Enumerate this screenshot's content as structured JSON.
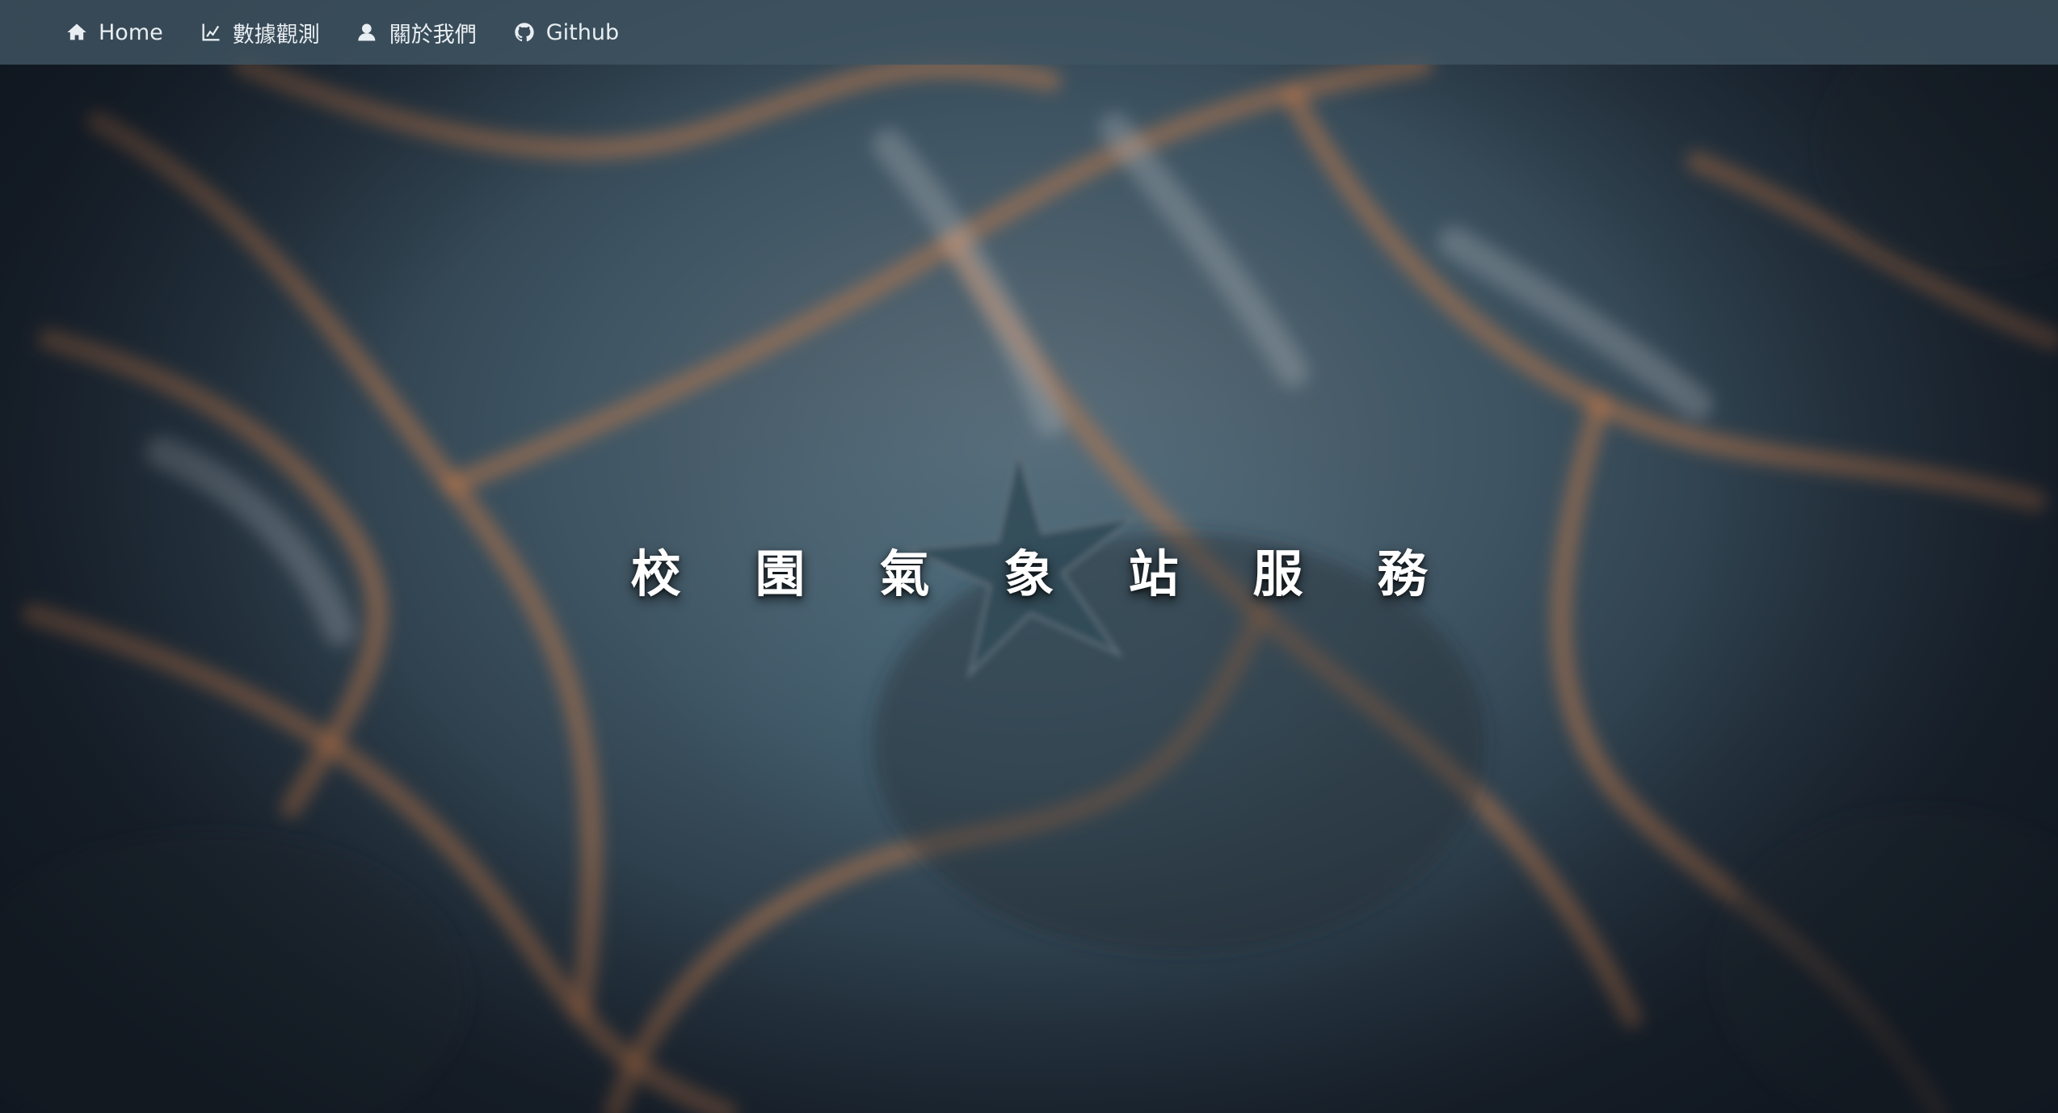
{
  "navbar": {
    "items": [
      {
        "label": "Home",
        "icon": "home-icon"
      },
      {
        "label": "數據觀測",
        "icon": "chart-line-icon"
      },
      {
        "label": "關於我們",
        "icon": "user-icon"
      },
      {
        "label": "Github",
        "icon": "github-icon"
      }
    ]
  },
  "hero": {
    "title": "校園氣象站服務",
    "background": "sandy sea floor with starfish",
    "colors": {
      "sand_blue": "#3e5462",
      "sand_orange": "#b9764a",
      "nav_bg": "#405462"
    }
  }
}
